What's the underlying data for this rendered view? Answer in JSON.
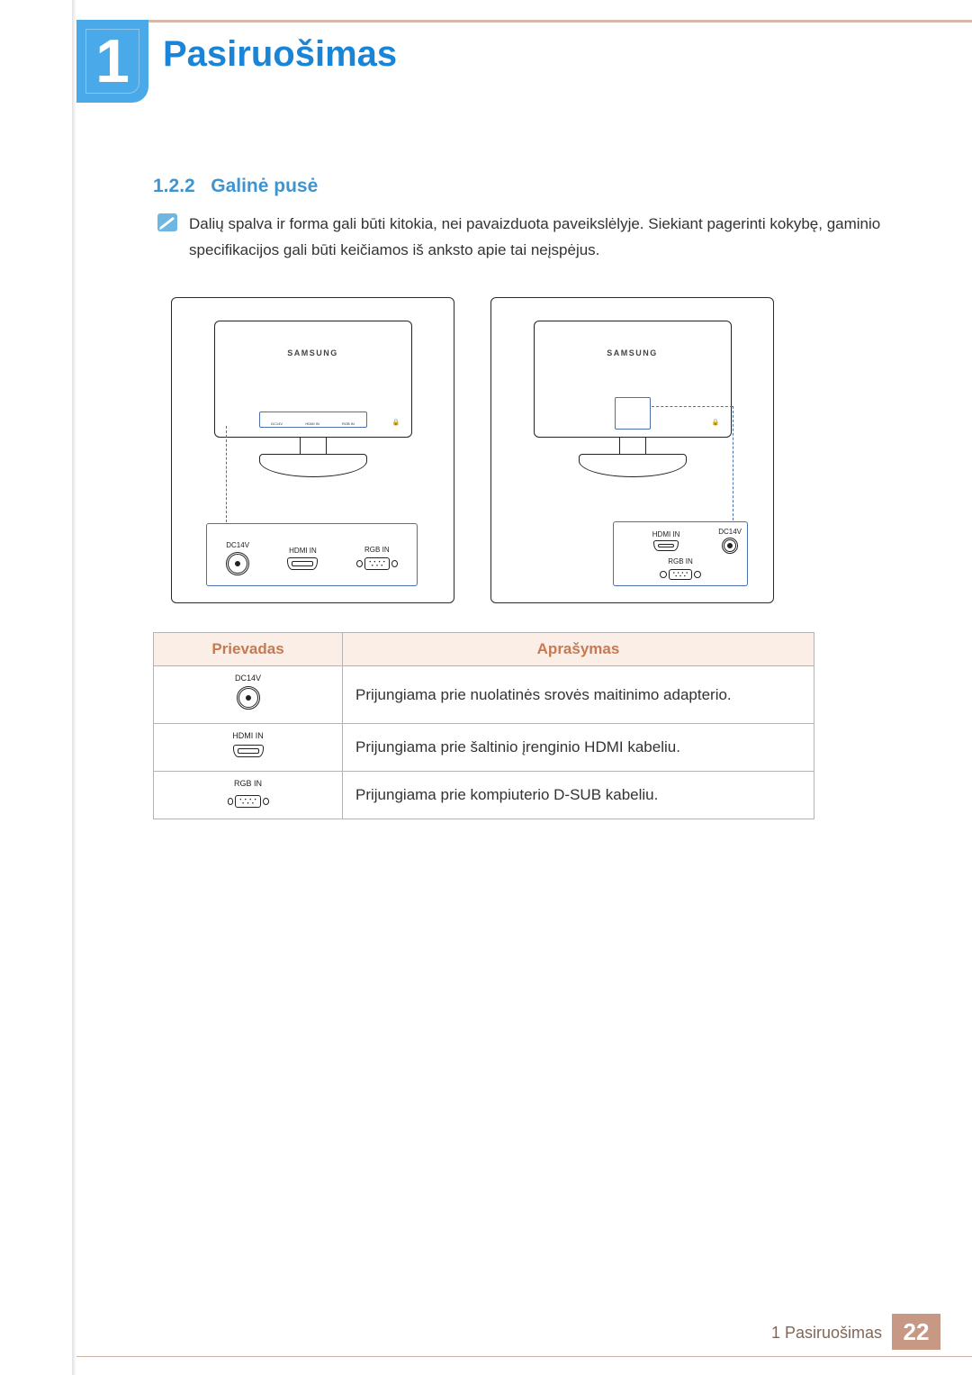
{
  "chapter": {
    "number": "1",
    "title": "Pasiruošimas"
  },
  "section": {
    "number": "1.2.2",
    "title": "Galinė pusė"
  },
  "note_text": "Dalių spalva ir forma gali būti kitokia, nei pavaizduota paveikslėlyje. Siekiant pagerinti kokybę, gaminio specifikacijos gali būti keičiamos iš anksto apie tai neįspėjus.",
  "diagram": {
    "brand": "SAMSUNG",
    "ports": {
      "dc": "DC14V",
      "hdmi": "HDMI IN",
      "rgb": "RGB IN"
    }
  },
  "table": {
    "headers": {
      "port": "Prievadas",
      "desc": "Aprašymas"
    },
    "rows": [
      {
        "portLabel": "DC14V",
        "portIcon": "dc",
        "desc": "Prijungiama prie nuolatinės srovės maitinimo adapterio."
      },
      {
        "portLabel": "HDMI IN",
        "portIcon": "hdmi",
        "desc": "Prijungiama prie šaltinio įrenginio HDMI kabeliu."
      },
      {
        "portLabel": "RGB IN",
        "portIcon": "vga",
        "desc": "Prijungiama prie kompiuterio D-SUB kabeliu."
      }
    ]
  },
  "footer": {
    "caption": "1 Pasiruošimas",
    "page": "22"
  }
}
